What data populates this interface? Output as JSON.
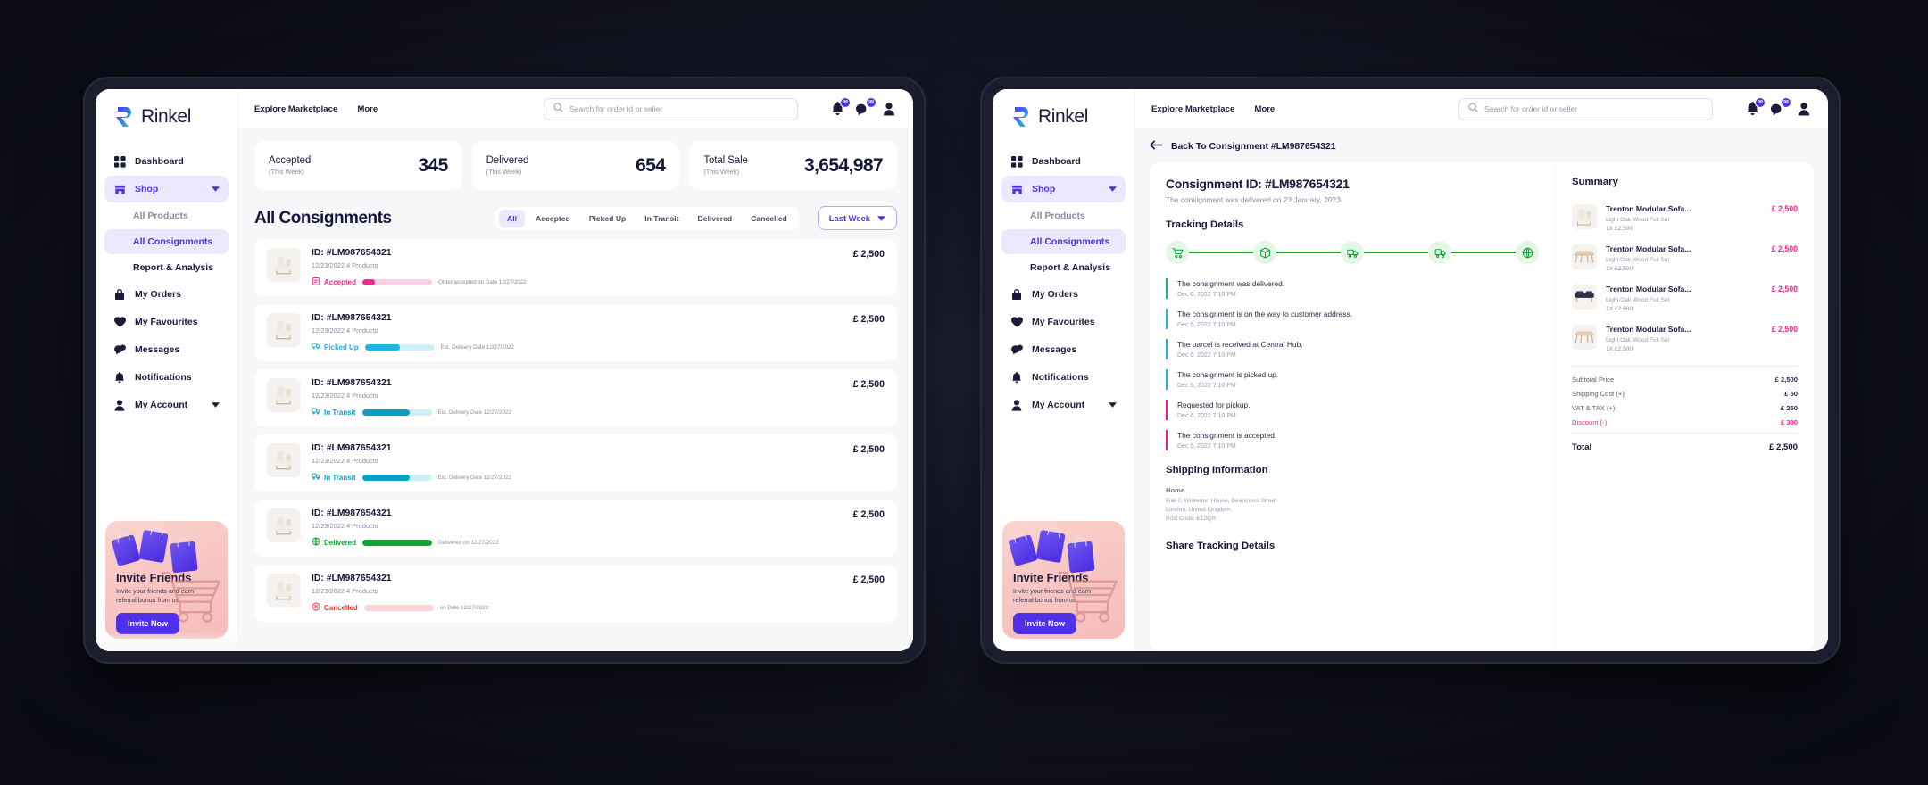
{
  "brand": {
    "name": "Rinkel"
  },
  "sidebar": {
    "items": [
      {
        "label": "Dashboard",
        "icon": "grid-icon",
        "active": false,
        "caret": false
      },
      {
        "label": "Shop",
        "icon": "store-icon",
        "active": true,
        "caret": true
      },
      {
        "label": "All Products",
        "sub": true,
        "active": false
      },
      {
        "label": "All Consignments",
        "sub": true,
        "active": true
      },
      {
        "label": "Report & Analysis",
        "sub": true,
        "active": false
      },
      {
        "label": "My Orders",
        "icon": "bag-icon",
        "active": false,
        "caret": false
      },
      {
        "label": "My Favourites",
        "icon": "heart-icon",
        "active": false,
        "caret": false
      },
      {
        "label": "Messages",
        "icon": "chat-icon",
        "active": false,
        "caret": false
      },
      {
        "label": "Notifications",
        "icon": "bell-icon",
        "active": false,
        "caret": false
      },
      {
        "label": "My Account",
        "icon": "user-icon",
        "active": false,
        "caret": true
      }
    ],
    "invite": {
      "title": "Invite Friends",
      "subtitle": "Invite your friends and earn referral bonus from us.",
      "button": "Invite Now"
    }
  },
  "topbar": {
    "nav": [
      "Explore Marketplace",
      "More"
    ],
    "search_placeholder": "Search for order id or seller",
    "search_value": "",
    "notification_badge": "99",
    "message_badge": "99"
  },
  "stats": [
    {
      "label": "Accepted",
      "sub": "(This Week)",
      "value": "345"
    },
    {
      "label": "Delivered",
      "sub": "(This Week)",
      "value": "654"
    },
    {
      "label": "Total Sale",
      "sub": "(This Week)",
      "value": "3,654,987"
    }
  ],
  "consignments": {
    "title": "All Consignments",
    "filters": [
      "All",
      "Accepted",
      "Picked Up",
      "In Transit",
      "Delivered",
      "Cancelled"
    ],
    "active_filter": "All",
    "period": "Last Week",
    "rows": [
      {
        "id": "ID: #LM987654321",
        "meta": "12/23/2022   4 Products",
        "status": "Accepted",
        "status_icon": "clipboard-icon",
        "note": "Order accepted on Date 12/27/2022",
        "progress": 18,
        "color": "#f0278f",
        "track": "#fbd0e6",
        "price": "£ 2,500"
      },
      {
        "id": "ID: #LM987654321",
        "meta": "12/23/2022   4 Products",
        "status": "Picked Up",
        "status_icon": "truck-load-icon",
        "note": "Est. Delivery Date 12/27/2022",
        "progress": 50,
        "color": "#18b6e0",
        "track": "#cdeffa",
        "price": "£ 2,500"
      },
      {
        "id": "ID: #LM987654321",
        "meta": "12/23/2022   4 Products",
        "status": "In Transit",
        "status_icon": "truck-icon",
        "note": "Est. Delivery Date 12/27/2022",
        "progress": 68,
        "color": "#0c9fc4",
        "track": "#cdeffa",
        "price": "£ 2,500"
      },
      {
        "id": "ID: #LM987654321",
        "meta": "12/23/2022   4 Products",
        "status": "In Transit",
        "status_icon": "truck-icon",
        "note": "Est. Delivery Date 12/27/2022",
        "progress": 68,
        "color": "#0c9fc4",
        "track": "#cdeffa",
        "price": "£ 2,500"
      },
      {
        "id": "ID: #LM987654321",
        "meta": "12/23/2022   4 Products",
        "status": "Delivered",
        "status_icon": "globe-check-icon",
        "note": "Delivered on 12/27/2022",
        "progress": 100,
        "color": "#11a335",
        "track": "#cdeecd",
        "price": "£ 2,500"
      },
      {
        "id": "ID: #LM987654321",
        "meta": "12/23/2022   4 Products",
        "status": "Cancelled",
        "status_icon": "cancel-icon",
        "note": "on Date 12/27/2022",
        "progress": 0,
        "color": "#e8373b",
        "track": "#fad6d7",
        "price": "£ 2,500"
      }
    ]
  },
  "detail": {
    "back_label": "Back To Consignment #LM987654321",
    "title": "Consignment ID: #LM987654321",
    "subtitle": "The consignment was delivered on 23 January, 2023.",
    "tracking_title": "Tracking Details",
    "steps": [
      "cart-icon",
      "box-icon",
      "truck-load-icon",
      "truck-icon",
      "globe-check-icon"
    ],
    "timeline": [
      {
        "text": "The consignment was delivered.",
        "time": "Dec 6, 2022 7:10 PM",
        "tone": "green"
      },
      {
        "text": "The consignment is on the way to customer address.",
        "time": "Dec 6, 2022 7:10 PM",
        "tone": "blue"
      },
      {
        "text": "The parcel is received at Central Hub.",
        "time": "Dec 6, 2022 7:10 PM",
        "tone": "blue"
      },
      {
        "text": "The consignment is picked up.",
        "time": "Dec 6, 2022 7:10 PM",
        "tone": "blue"
      },
      {
        "text": "Requested for pickup.",
        "time": "Dec 6, 2022 7:10 PM",
        "tone": "pink"
      },
      {
        "text": "The consignment is accepted.",
        "time": "Dec 6, 2022 7:10 PM",
        "tone": "pink"
      }
    ],
    "shipping_title": "Shipping Information",
    "shipping": {
      "name": "Home",
      "line1": "Flat-7, Winterton House, Deancross Street",
      "line2": "London, United Kingdom.",
      "line3": "Post Code: E12QR"
    },
    "share_title": "Share Tracking Details",
    "summary_title": "Summary",
    "summary_items": [
      {
        "name": "Trenton Modular Sofa...",
        "attr": "Light Oak Wood   Full Set",
        "qty": "1X £2,500",
        "price": "£ 2,500",
        "thumb": "chair"
      },
      {
        "name": "Trenton Modular Sofa...",
        "attr": "Light Oak Wood   Full Set",
        "qty": "1X £2,500",
        "price": "£ 2,500",
        "thumb": "table"
      },
      {
        "name": "Trenton Modular Sofa...",
        "attr": "Light Oak Wood   Full Set",
        "qty": "1X £2,500",
        "price": "£ 2,500",
        "thumb": "dark"
      },
      {
        "name": "Trenton Modular Sofa...",
        "attr": "Light Oak Wood   Full Set",
        "qty": "1X £2,500",
        "price": "£ 2,500",
        "thumb": "table"
      }
    ],
    "totals": [
      {
        "label": "Subtotal Price",
        "value": "£ 2,500",
        "kind": "normal"
      },
      {
        "label": "Shipping Cost (+)",
        "value": "£ 50",
        "kind": "normal"
      },
      {
        "label": "VAT & TAX (+)",
        "value": "£ 250",
        "kind": "normal"
      },
      {
        "label": "Discount (-)",
        "value": "£ 300",
        "kind": "discount"
      }
    ],
    "grand_total": {
      "label": "Total",
      "value": "£ 2,500"
    }
  },
  "colors": {
    "accent": "#4f32e8",
    "accent_soft": "#ece8ff",
    "pink": "#f0278f",
    "green": "#11a335",
    "blue": "#18b6e0",
    "ink": "#15163a"
  }
}
